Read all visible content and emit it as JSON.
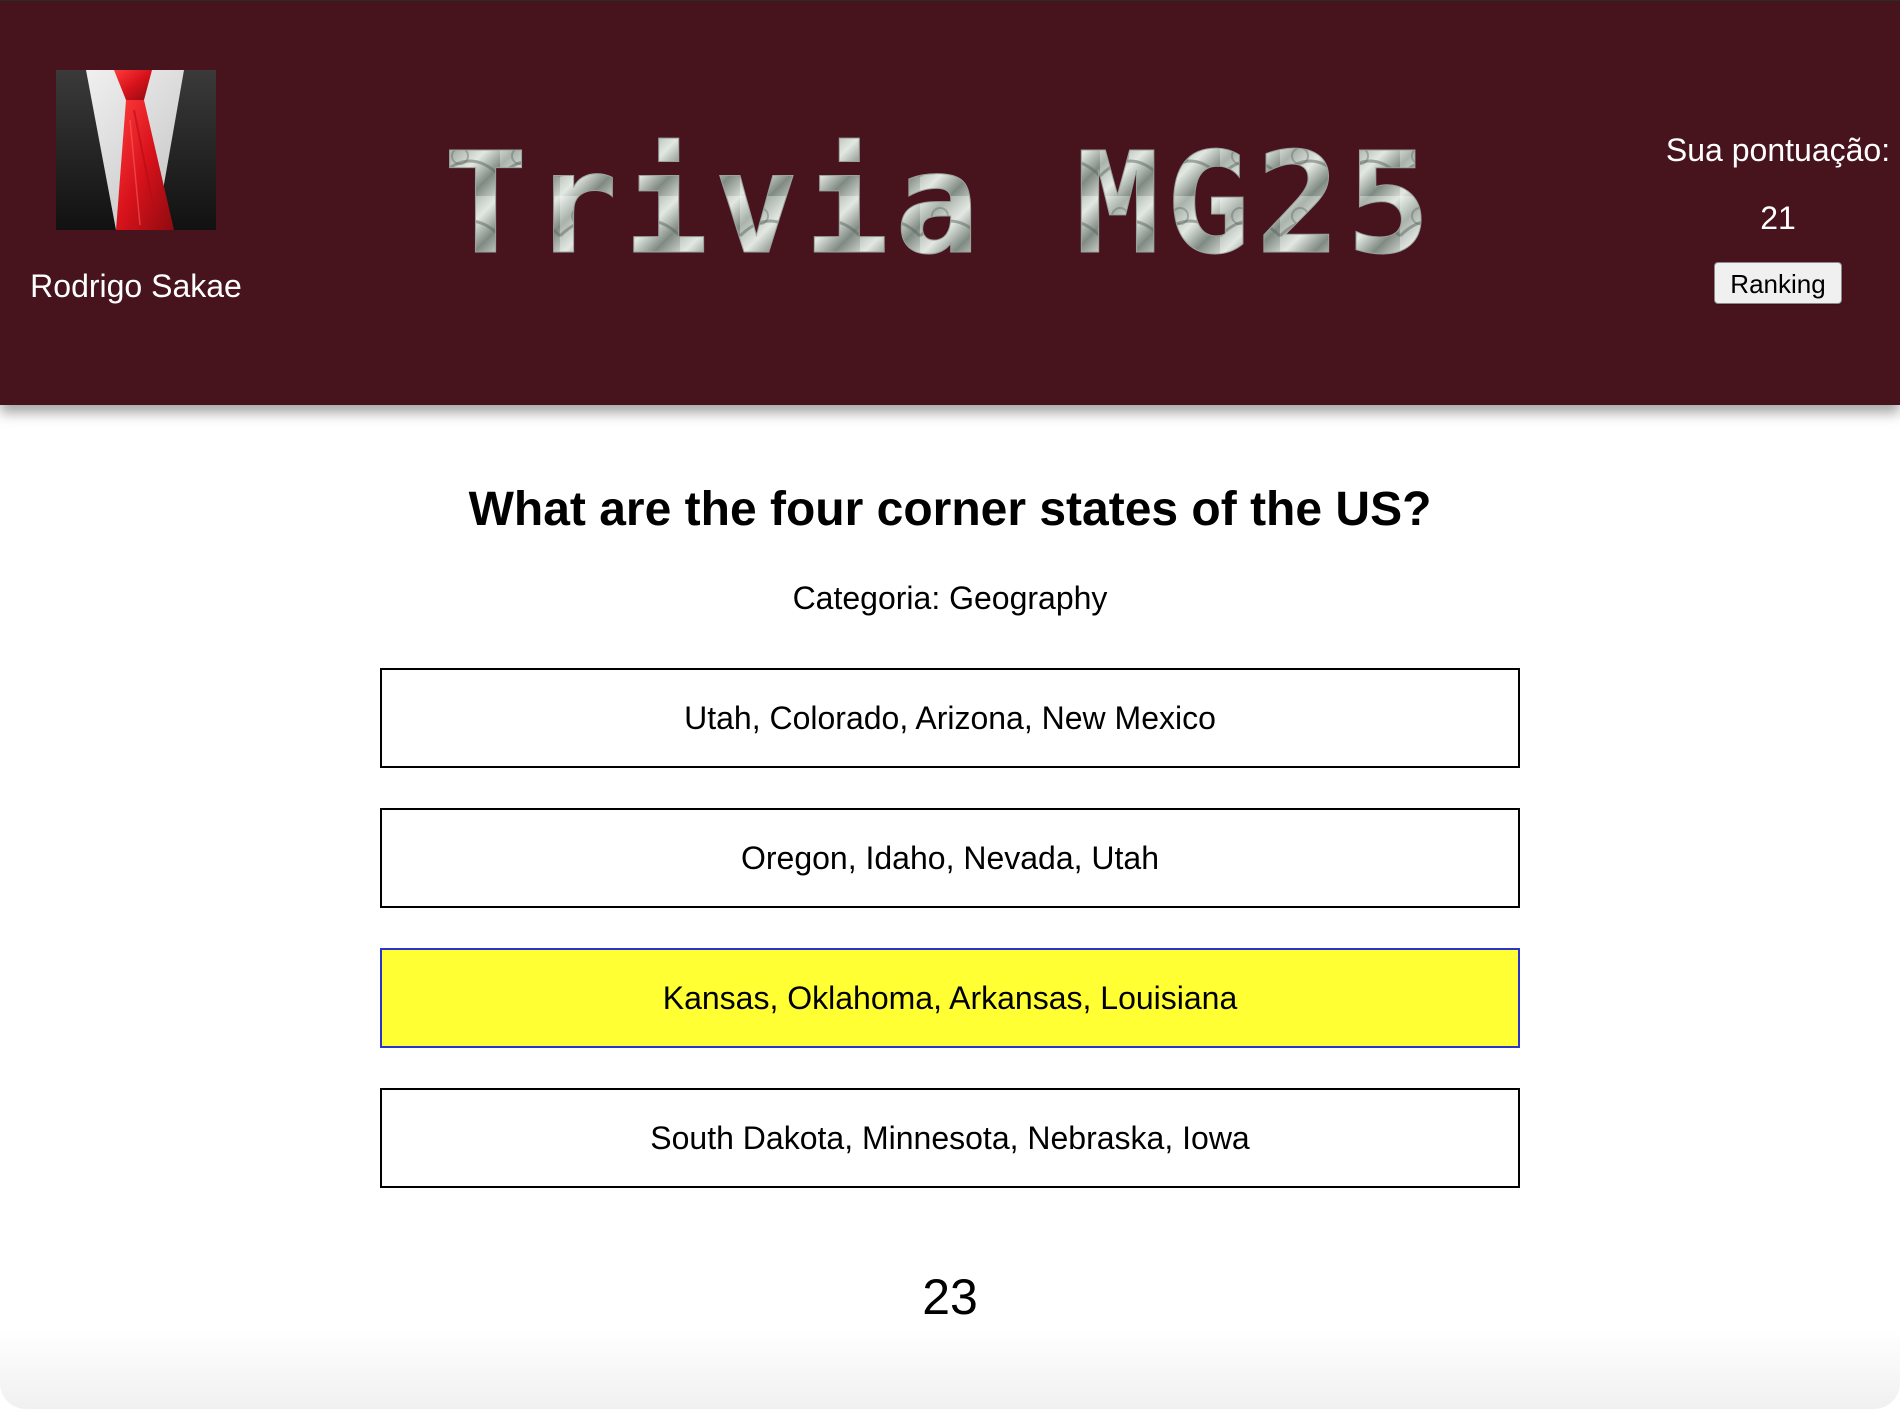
{
  "header": {
    "user_name": "Rodrigo Sakae",
    "logo_text": "Trivia MG25",
    "score_label": "Sua pontuação:",
    "score_value": "21",
    "ranking_label": "Ranking"
  },
  "question": {
    "text": "What are the four corner states of the US?",
    "category": "Categoria: Geography"
  },
  "answers": [
    {
      "label": "Utah, Colorado, Arizona, New Mexico",
      "selected": false
    },
    {
      "label": "Oregon, Idaho, Nevada, Utah",
      "selected": false
    },
    {
      "label": "Kansas, Oklahoma, Arkansas, Louisiana",
      "selected": true
    },
    {
      "label": "South Dakota, Minnesota, Nebraska, Iowa",
      "selected": false
    }
  ],
  "timer": "23",
  "colors": {
    "header_bg": "#47141e",
    "selected_answer_bg": "#ffff33",
    "selected_answer_border": "#2b35c9"
  }
}
